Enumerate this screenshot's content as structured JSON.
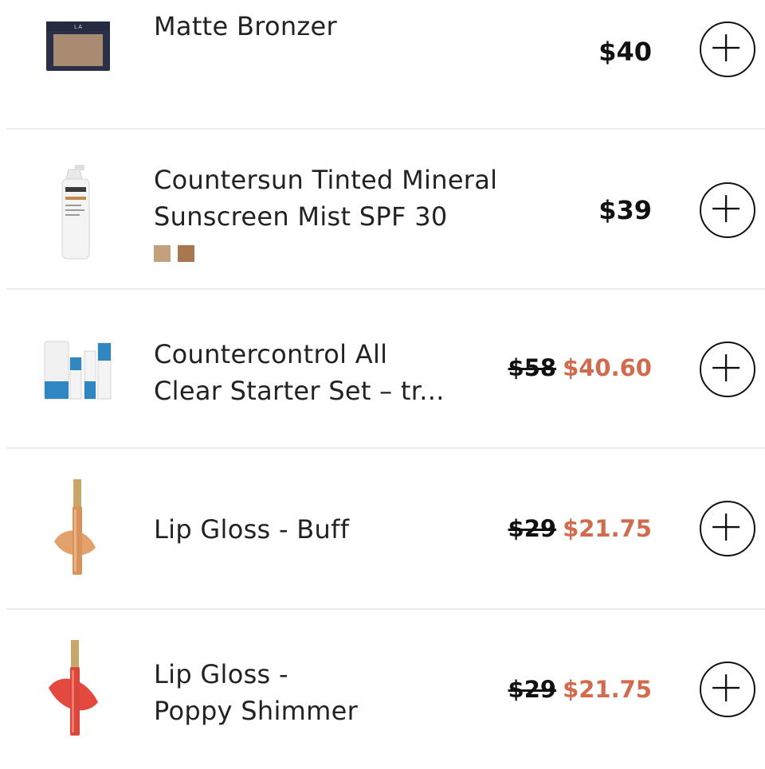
{
  "products": [
    {
      "name_lines": [
        "Matte Bronzer"
      ],
      "price": "$40",
      "image_icon": "bronzer-compact-icon",
      "swatches": []
    },
    {
      "name_lines": [
        "Countersun Tinted Mineral",
        "Sunscreen Mist SPF 30"
      ],
      "price": "$39",
      "image_icon": "sunscreen-bottle-icon",
      "swatches": [
        "#c4a07c",
        "#a8774f"
      ]
    },
    {
      "name_lines": [
        "Countercontrol All",
        "Clear Starter Set – tr..."
      ],
      "original_price": "$58",
      "sale_price": "$40.60",
      "image_icon": "starter-set-icon",
      "swatches": []
    },
    {
      "name_lines": [
        "Lip Gloss - Buff"
      ],
      "original_price": "$29",
      "sale_price": "$21.75",
      "image_icon": "lip-gloss-buff-icon",
      "swatches": []
    },
    {
      "name_lines": [
        "Lip Gloss -",
        "Poppy Shimmer"
      ],
      "original_price": "$29",
      "sale_price": "$21.75",
      "image_icon": "lip-gloss-poppy-icon",
      "swatches": []
    }
  ],
  "add_button_icon": "plus-icon",
  "colors": {
    "sale_price": "#d06b4e",
    "text": "#222222",
    "divider": "#ececec"
  }
}
